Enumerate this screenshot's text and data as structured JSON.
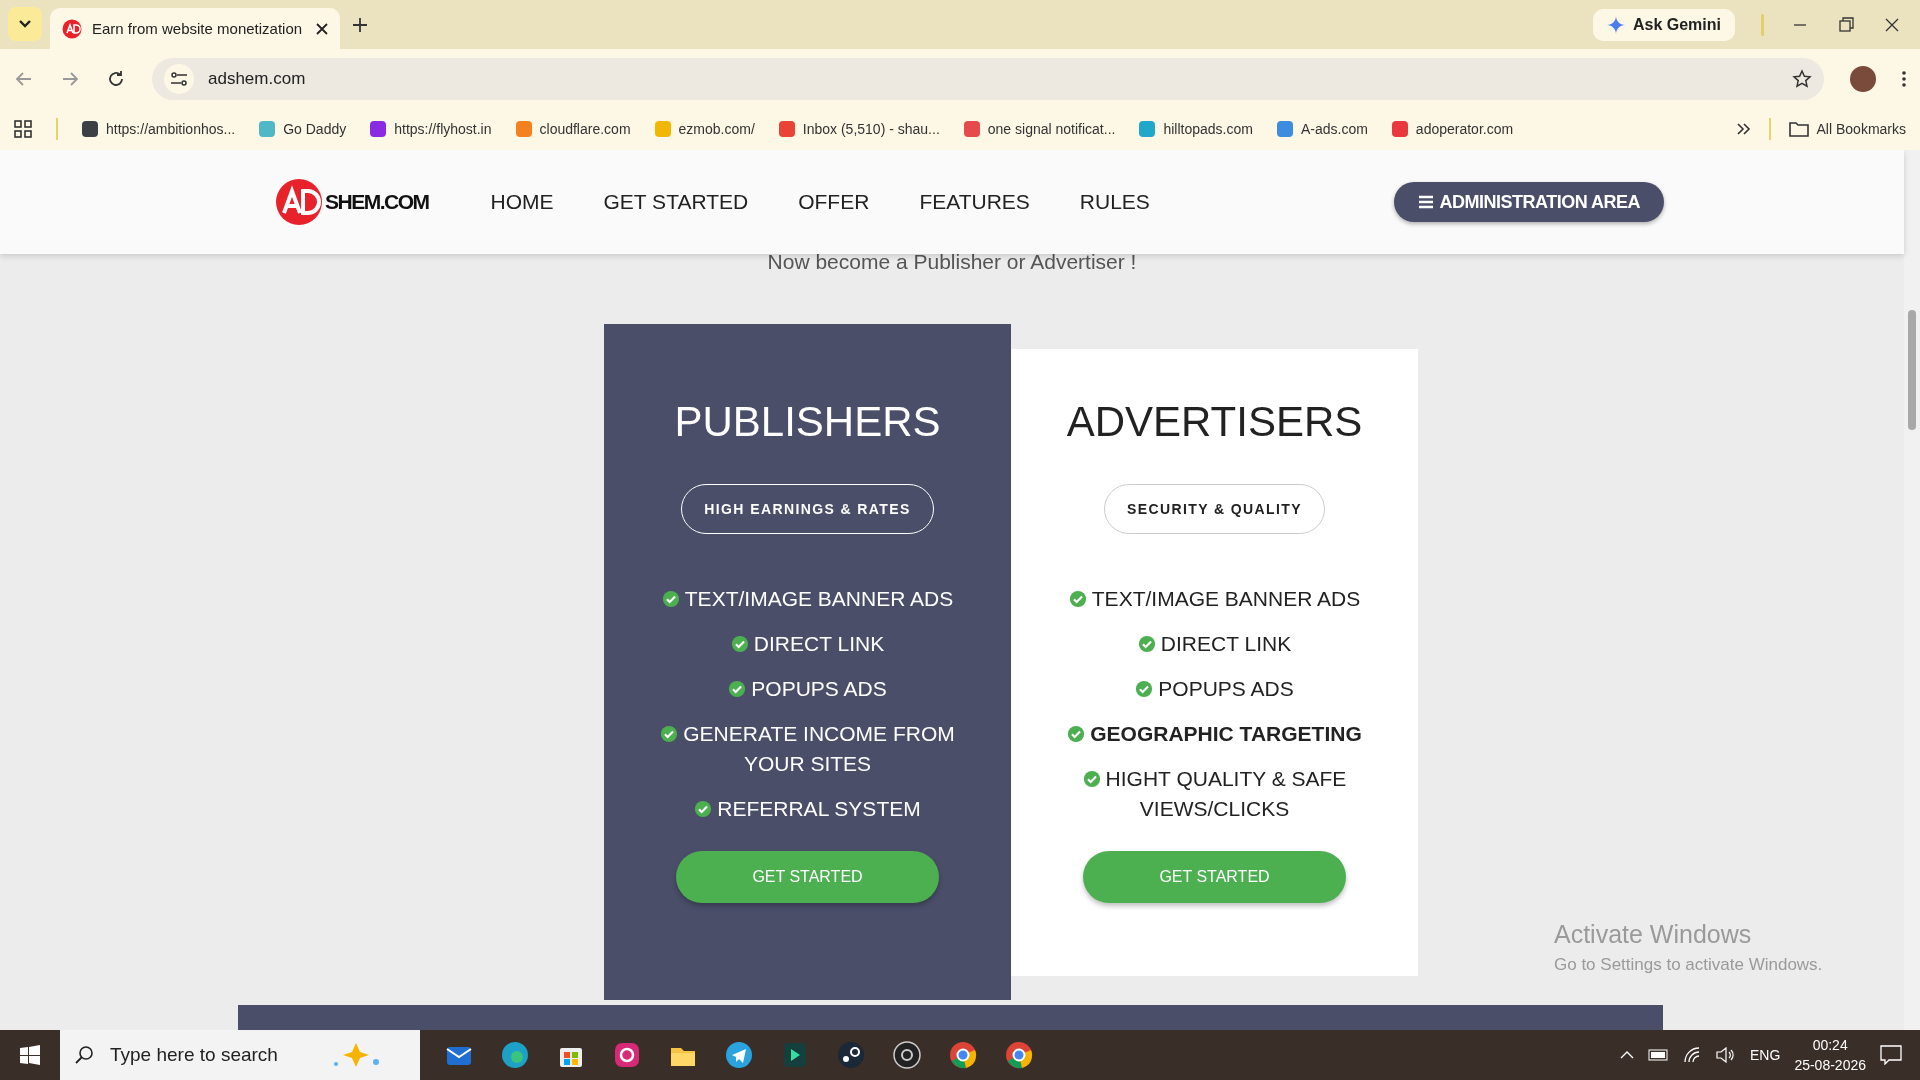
{
  "browser": {
    "tabs": [
      {
        "title": "Earn from website monetization",
        "selected": true
      }
    ],
    "gemini": "Ask Gemini",
    "address": "adshem.com",
    "bookmarks": [
      {
        "label": "https://ambitionhos...",
        "color": "#3c4043"
      },
      {
        "label": "Go Daddy",
        "color": "#4fb8c4"
      },
      {
        "label": "https://flyhost.in",
        "color": "#8a2be2"
      },
      {
        "label": "cloudflare.com",
        "color": "#f48120"
      },
      {
        "label": "ezmob.com/",
        "color": "#f2b705"
      },
      {
        "label": "Inbox (5,510) - shau...",
        "color": "#ea4335"
      },
      {
        "label": "one signal notificat...",
        "color": "#e54b4d"
      },
      {
        "label": "hilltopads.com",
        "color": "#1fa8c9"
      },
      {
        "label": "A-ads.com",
        "color": "#3c8de0"
      },
      {
        "label": "adoperator.com",
        "color": "#e8383d"
      }
    ],
    "all_bookmarks": "All Bookmarks"
  },
  "site": {
    "logo_text": "SHEM.COM",
    "nav": [
      {
        "label": "HOME"
      },
      {
        "label": "GET STARTED"
      },
      {
        "label": "OFFER"
      },
      {
        "label": "FEATURES"
      },
      {
        "label": "RULES"
      }
    ],
    "admin_button": "ADMINISTRATION AREA",
    "subtitle": "Now become a Publisher or Advertiser !",
    "cards": [
      {
        "kind": "dark",
        "title": "PUBLISHERS",
        "badge": "HIGH EARNINGS & RATES",
        "features": [
          {
            "text": "TEXT/IMAGE BANNER ADS",
            "bold": false
          },
          {
            "text": "DIRECT LINK",
            "bold": false
          },
          {
            "text": "POPUPS ADS",
            "bold": false
          },
          {
            "text": "GENERATE INCOME FROM YOUR SITES",
            "bold": false
          },
          {
            "text": "REFERRAL SYSTEM",
            "bold": false
          }
        ],
        "button": "GET STARTED"
      },
      {
        "kind": "light",
        "title": "ADVERTISERS",
        "badge": "SECURITY & QUALITY",
        "features": [
          {
            "text": "TEXT/IMAGE BANNER ADS",
            "bold": false
          },
          {
            "text": "DIRECT LINK",
            "bold": false
          },
          {
            "text": "POPUPS ADS",
            "bold": false
          },
          {
            "text": "GEOGRAPHIC TARGETING",
            "bold": true
          },
          {
            "text": "HIGHT QUALITY & SAFE VIEWS/CLICKS",
            "bold": false
          }
        ],
        "button": "GET STARTED"
      }
    ]
  },
  "activation": {
    "title": "Activate Windows",
    "subtitle": "Go to Settings to activate Windows."
  },
  "taskbar": {
    "search_placeholder": "Type here to search",
    "language": "ENG",
    "time": "00:24",
    "date": "25-08-2026"
  }
}
